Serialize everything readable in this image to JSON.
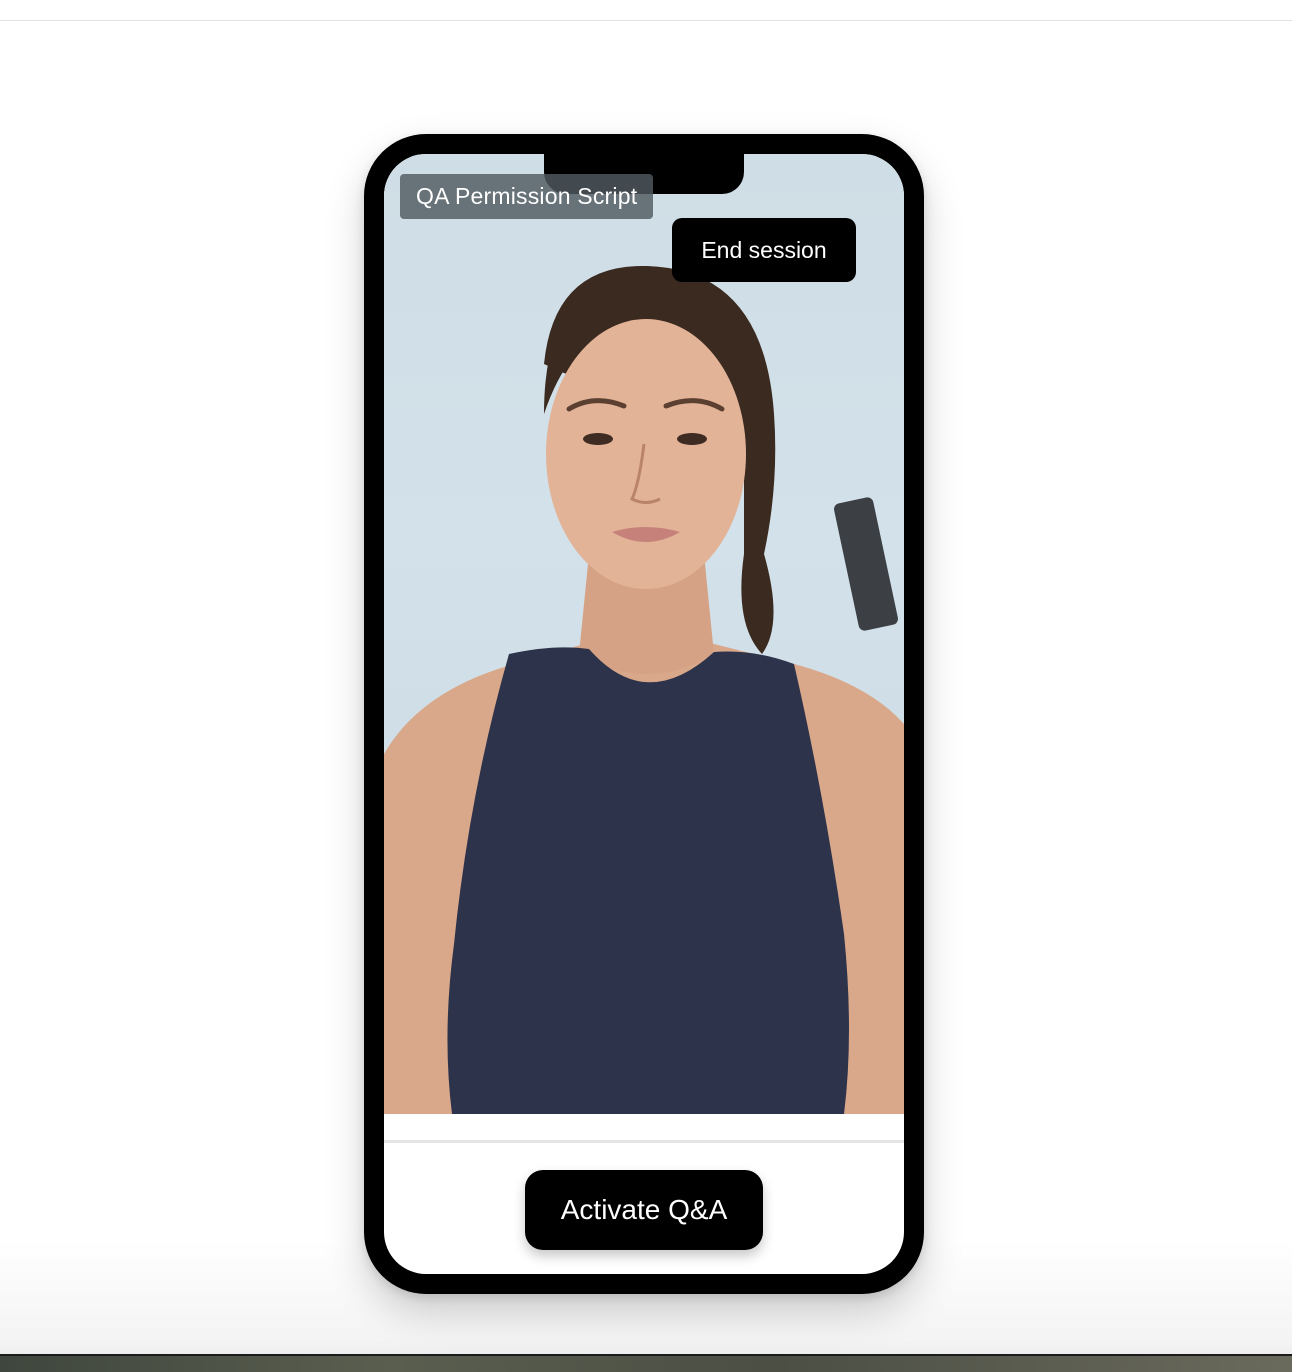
{
  "session": {
    "title": "QA Permission Script",
    "end_button_label": "End session",
    "activate_button_label": "Activate Q&A"
  },
  "video": {
    "subject": "presenter-avatar-video",
    "background_color": "#cfdde6",
    "top_color": "#2d334a"
  }
}
